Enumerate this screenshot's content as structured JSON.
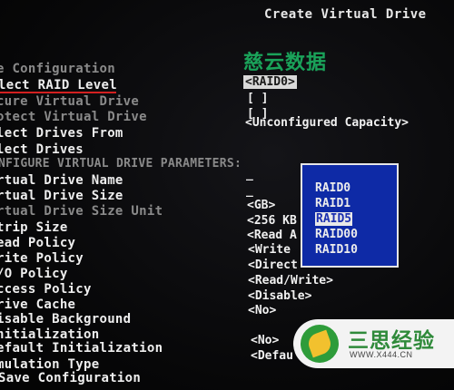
{
  "header": {
    "title": "Create Virtual Drive"
  },
  "watermark": "慈云数据",
  "menu": {
    "base_config": "e Configuration",
    "raid_level": "lect RAID Level",
    "secure_vd": "cure Virtual Drive",
    "protect_vd": "otect Virtual Drive",
    "select_from": "lect Drives From",
    "select_drives": "lect Drives",
    "section": "NFIGURE VIRTUAL DRIVE PARAMETERS:",
    "vd_name": "rtual Drive Name",
    "vd_size": "rtual Drive Size",
    "vd_size_unit": "rtual Drive Size Unit",
    "strip_size": "trip Size",
    "read_policy": "ead Policy",
    "write_policy": "rite Policy",
    "io_policy": "/O Policy",
    "access_policy": "ccess Policy",
    "drive_cache": "rive Cache",
    "disable_bgi": "isable Background",
    "initialization": "nitialization",
    "default_init": "efault Initialization",
    "emulation": "mulation Type",
    "save": "Save Configuration"
  },
  "values": {
    "raid_level": "<RAID0>",
    "secure": "[ ]",
    "protect": "[ ]",
    "select_from": "<Unconfigured Capacity>",
    "vd_name": "_",
    "vd_size": "_",
    "size_unit": "<GB>",
    "strip_size": "<256 KB",
    "read_policy": "<Read A",
    "write_policy": "<Write",
    "io_policy": "<Direct",
    "access_policy": "<Read/Write>",
    "drive_cache": "<Disable>",
    "disable_bgi": "<No>",
    "default_init": "<No>",
    "emulation": "<Defau"
  },
  "raid_popup": {
    "options": [
      "RAID0",
      "RAID1",
      "RAID5",
      "RAID00",
      "RAID10"
    ],
    "highlighted": "RAID5"
  },
  "logo": {
    "name": "三思经验",
    "url": "WWW.X444.CN"
  }
}
